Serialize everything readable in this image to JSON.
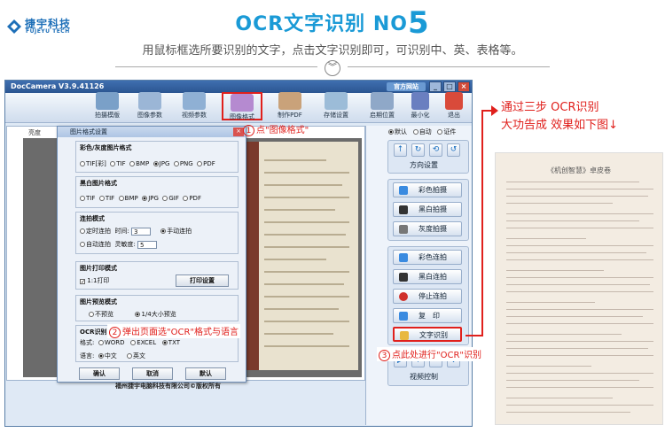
{
  "header": {
    "title_prefix": "OCR文字识别 NO",
    "title_number": "5",
    "subtitle": "用鼠标框选所要识别的文字，点击文字识别即可，可识别中、英、表格等。"
  },
  "app": {
    "window_title": "DocCamera V3.9.41126",
    "top_link": "官方网站",
    "window_controls": [
      "_",
      "□",
      "×"
    ],
    "logo": {
      "cn": "捷宇科技",
      "en": "FUJEYU TECH"
    },
    "toolbar": [
      {
        "label": "拍摄模版",
        "color": "#7aa0c8"
      },
      {
        "label": "图像参数",
        "color": "#9bb6d6"
      },
      {
        "label": "视频参数",
        "color": "#8fb0d4"
      },
      {
        "label": "图像格式",
        "color": "#b58ad0"
      },
      {
        "label": "制作PDF",
        "color": "#c9a27a"
      },
      {
        "label": "存储设置",
        "color": "#9cbcd8"
      },
      {
        "label": "启期位置",
        "color": "#8fa8c8"
      },
      {
        "label": "最小化",
        "color": "#6a7fc0"
      },
      {
        "label": "退出",
        "color": "#d94a3a"
      }
    ],
    "left_header": "亮度",
    "copyright": "福州捷宇电脑科技有限公司©版权所有"
  },
  "dialog": {
    "title": "图片格式设置",
    "color_format": {
      "title": "彩色/灰度图片格式",
      "options": [
        "TIF[彩]",
        "TIF",
        "BMP",
        "JPG",
        "PNG",
        "PDF"
      ],
      "selected": "JPG"
    },
    "bw_format": {
      "title": "黑白图片格式",
      "options": [
        "TIF",
        "TIF",
        "BMP",
        "JPG",
        "GIF",
        "PDF"
      ],
      "selected": "JPG"
    },
    "continuous": {
      "title": "连拍模式",
      "timed_label": "定时连拍",
      "time_label": "时间:",
      "time_value": "3",
      "manual_label": "手动连拍",
      "auto_label": "自动连拍",
      "sensitivity_label": "灵敏度:",
      "sensitivity_value": "5"
    },
    "print_mode": {
      "title": "图片打印模式",
      "option": "1:1打印",
      "button": "打印设置"
    },
    "preview_mode": {
      "title": "图片预览模式",
      "option_none": "不预览",
      "option_quarter": "1/4大小预览"
    },
    "ocr": {
      "title": "OCR识别",
      "format_label": "格式:",
      "formats": [
        "WORD",
        "EXCEL",
        "TXT"
      ],
      "selected_format": "TXT",
      "lang_label": "语言:",
      "langs": [
        "中文",
        "英文"
      ],
      "selected_lang": "中文"
    },
    "buttons": [
      "确认",
      "取消",
      "默认"
    ]
  },
  "annotations": {
    "step1_num": "1",
    "step1_text": "点\"图像格式\"",
    "step2_num": "2",
    "step2_text": "弹出页面选\"OCR\"格式与语言",
    "step3_num": "3",
    "step3_text": "点此处进行\"OCR\"识别"
  },
  "right_panel": {
    "mode_options": [
      "默认",
      "自动",
      "证件"
    ],
    "selected_mode": "默认",
    "direction_label": "方向设置",
    "direction_icons": [
      "↑",
      "↻",
      "⟲",
      "↺"
    ],
    "capture_buttons": [
      {
        "label": "彩色拍摄",
        "color": "#3a8be0"
      },
      {
        "label": "黑白拍摄",
        "color": "#333333"
      },
      {
        "label": "灰度拍摄",
        "color": "#777777"
      }
    ],
    "action_buttons": [
      {
        "label": "彩色连拍",
        "color": "#3a8be0"
      },
      {
        "label": "黑白连拍",
        "color": "#333333"
      },
      {
        "label": "停止连拍",
        "color": "#d0302a"
      },
      {
        "label": "复　印",
        "color": "#3a8be0"
      },
      {
        "label": "文字识别",
        "color": "#e8b840"
      }
    ],
    "video_icons": [
      "▶",
      "+",
      "-",
      "✥"
    ],
    "video_label": "视频控制"
  },
  "callout": {
    "line1": "通过三步  OCR识别",
    "line2": "大功告成  效果如下图↓"
  },
  "result_doc": {
    "title": "《机创智慧》卓皮卷"
  },
  "colors": {
    "brand_blue": "#1a9ad6",
    "annotation_red": "#e0201c"
  }
}
